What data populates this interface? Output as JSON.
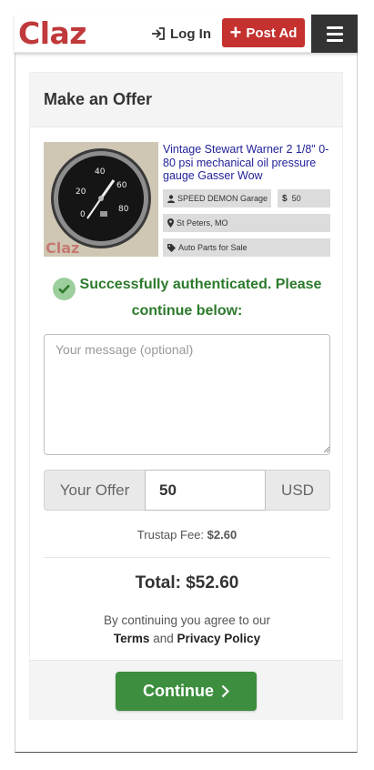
{
  "header": {
    "logo": "Claz",
    "login_label": "Log In",
    "post_ad_label": "Post Ad"
  },
  "offer_card": {
    "title": "Make an Offer",
    "listing": {
      "title": "Vintage Stewart Warner 2 1/8\" 0-80 psi mechanical oil pressure gauge Gasser Wow",
      "seller": "SPEED DEMON Garage",
      "price": "50",
      "location": "St Peters, MO",
      "category": "Auto Parts for Sale",
      "image_watermark": "Claz"
    },
    "auth_message": "Successfully authenticated. Please continue below:",
    "message_placeholder": "Your message (optional)",
    "offer_label": "Your Offer",
    "offer_value": "50",
    "currency": "USD",
    "fee_label": "Trustap Fee:",
    "fee_value": "$2.60",
    "total": "Total: $52.60",
    "agree_text": "By continuing you agree to our",
    "terms_label": "Terms",
    "and_text": "and",
    "privacy_label": "Privacy Policy",
    "continue_label": "Continue"
  },
  "colors": {
    "brand_red": "#c0393b",
    "post_ad_bg": "#c4312f",
    "success_green": "#2d7a2d",
    "continue_bg": "#3d8e3e",
    "menu_bg": "#333333",
    "link_blue": "#22229a"
  },
  "icons": {
    "login": "sign-in-icon",
    "post_ad": "plus-icon",
    "menu": "hamburger-icon",
    "seller": "user-icon",
    "price": "dollar-icon",
    "location": "map-marker-icon",
    "category": "tag-icon",
    "auth": "check-circle-icon",
    "continue": "chevron-right-icon"
  }
}
